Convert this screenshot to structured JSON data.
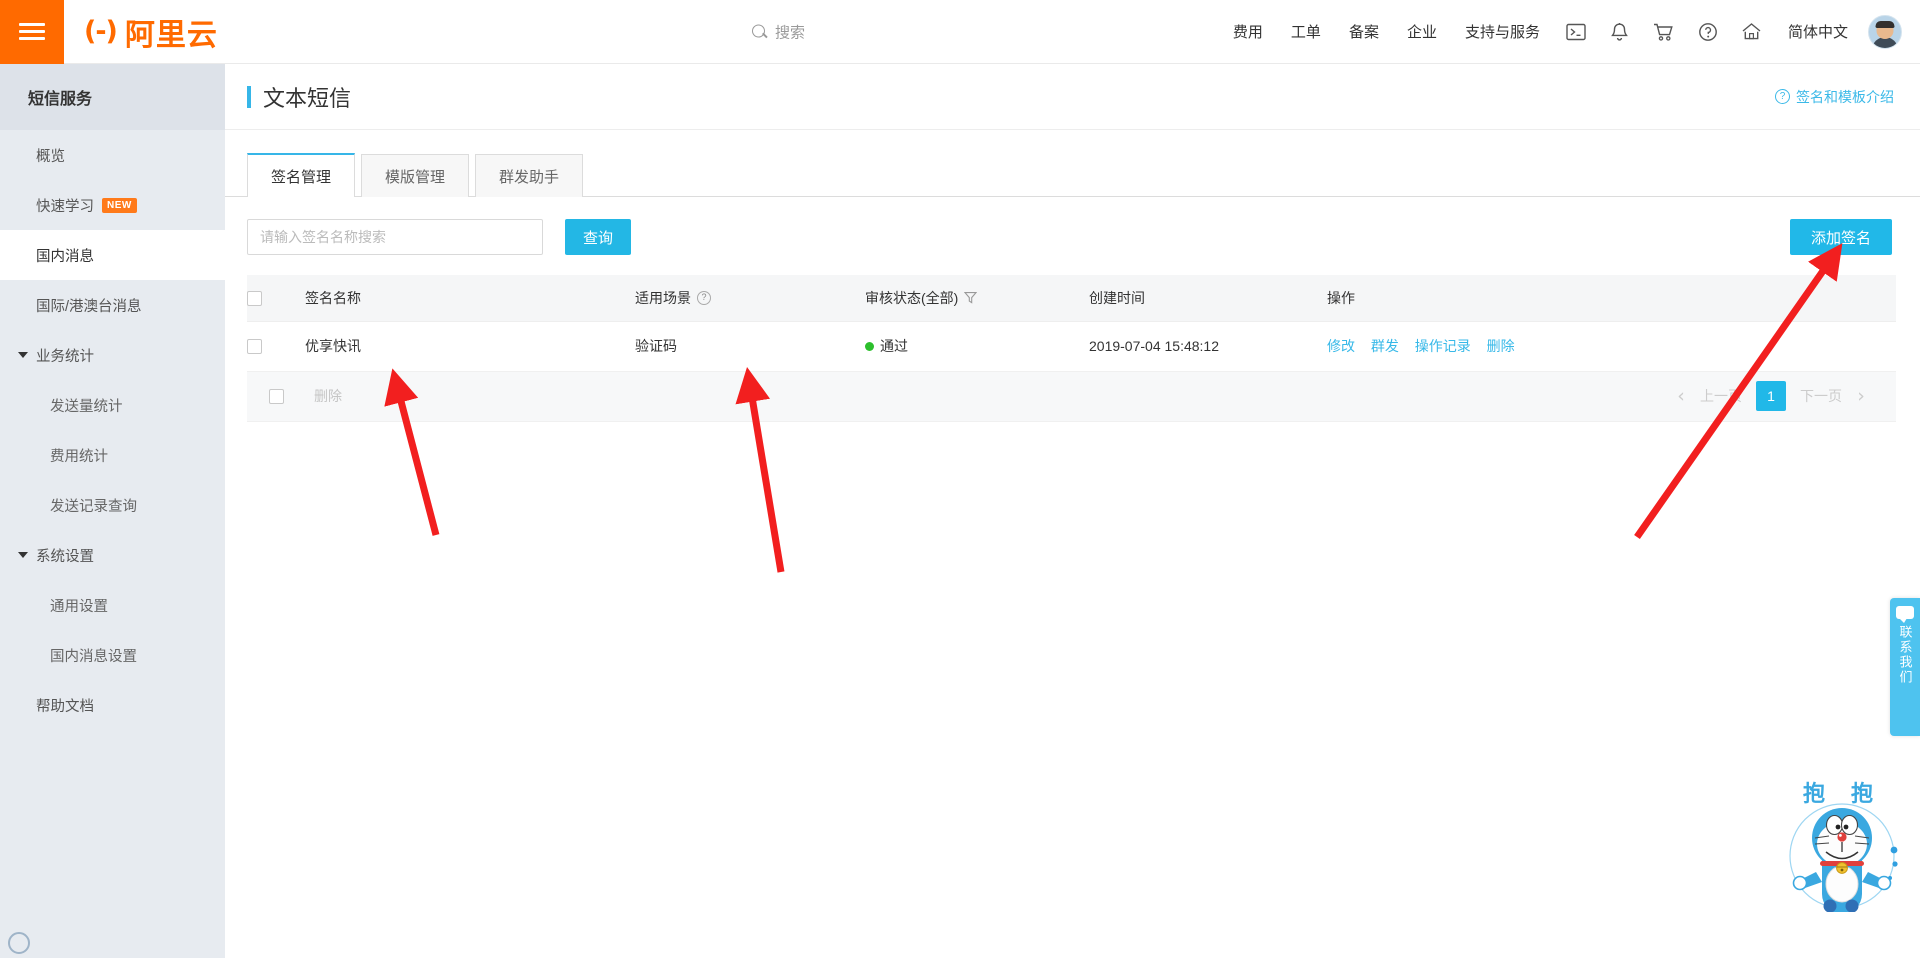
{
  "header": {
    "menu_icon": "hamburger-icon",
    "logo_bracket": "(-)",
    "logo_text": "阿里云",
    "search_placeholder": "搜索",
    "search_icon": "search-icon",
    "nav_links": [
      "费用",
      "工单",
      "备案",
      "企业",
      "支持与服务"
    ],
    "icons": [
      "terminal-icon",
      "bell-icon",
      "cart-icon",
      "help-icon",
      "home-icon"
    ],
    "language": "简体中文",
    "avatar": "user-avatar"
  },
  "sidebar": {
    "title": "短信服务",
    "items": [
      {
        "label": "概览",
        "type": "item",
        "active": false
      },
      {
        "label": "快速学习",
        "type": "item",
        "active": false,
        "badge": "NEW"
      },
      {
        "label": "国内消息",
        "type": "item",
        "active": true
      },
      {
        "label": "国际/港澳台消息",
        "type": "item",
        "active": false
      },
      {
        "label": "业务统计",
        "type": "group",
        "active": false
      },
      {
        "label": "发送量统计",
        "type": "sub",
        "active": false
      },
      {
        "label": "费用统计",
        "type": "sub",
        "active": false
      },
      {
        "label": "发送记录查询",
        "type": "sub",
        "active": false
      },
      {
        "label": "系统设置",
        "type": "group",
        "active": false
      },
      {
        "label": "通用设置",
        "type": "sub",
        "active": false
      },
      {
        "label": "国内消息设置",
        "type": "sub",
        "active": false
      },
      {
        "label": "帮助文档",
        "type": "item",
        "active": false
      }
    ]
  },
  "page": {
    "title": "文本短信",
    "intro_link": "签名和模板介绍",
    "intro_icon": "question-circle-icon"
  },
  "tabs": [
    {
      "label": "签名管理",
      "active": true
    },
    {
      "label": "模版管理",
      "active": false
    },
    {
      "label": "群发助手",
      "active": false
    }
  ],
  "filters": {
    "search_placeholder": "请输入签名名称搜索",
    "search_value": "",
    "query_button": "查询",
    "add_button": "添加签名"
  },
  "table": {
    "columns": [
      {
        "key": "check",
        "label": ""
      },
      {
        "key": "name",
        "label": "签名名称"
      },
      {
        "key": "scene",
        "label": "适用场景",
        "icon": "question-circle-icon"
      },
      {
        "key": "status",
        "label": "审核状态(全部)",
        "icon": "filter-funnel-icon"
      },
      {
        "key": "time",
        "label": "创建时间"
      },
      {
        "key": "ops",
        "label": "操作"
      }
    ],
    "rows": [
      {
        "name": "优享快讯",
        "scene": "验证码",
        "status": "通过",
        "status_color": "#2cbf2c",
        "time": "2019-07-04 15:48:12",
        "ops": [
          "修改",
          "群发",
          "操作记录",
          "删除"
        ]
      }
    ]
  },
  "footer": {
    "delete_label": "删除",
    "pagination": {
      "prev": "上一页",
      "next": "下一页",
      "pages": [
        "1"
      ],
      "current": "1"
    }
  },
  "widgets": {
    "contact_tab": "联系我们",
    "contact_icon": "chat-bubble-icon",
    "mascot_text": "抱 抱",
    "mascot_icon": "doraemon-mascot"
  },
  "colors": {
    "brand_orange": "#ff6a00",
    "accent_cyan": "#21b8e8",
    "status_green": "#2cbf2c",
    "link_blue": "#38b9e8",
    "sidebar_bg": "#e7ebf0",
    "annotation_red": "#f21f1f"
  }
}
